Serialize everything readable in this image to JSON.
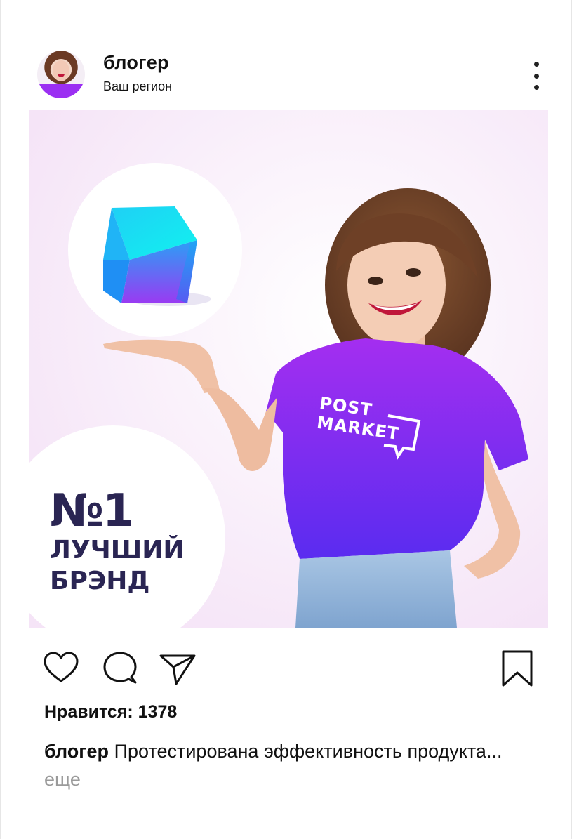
{
  "header": {
    "username": "блогер",
    "region": "Ваш регион",
    "more_icon": "more-vertical-icon"
  },
  "post": {
    "badge_title": "№1",
    "badge_line1": "ЛУЧШИЙ",
    "badge_line2": "БРЭНД",
    "tshirt_line1": "POST",
    "tshirt_line2": "MARKET",
    "colors": {
      "brand_purple": "#9b2ff2",
      "brand_blue": "#5a2bf0",
      "cube_cyan": "#10f0f0",
      "cube_magenta": "#d02af0",
      "badge_text": "#2a2553"
    }
  },
  "actions": {
    "like_icon": "heart-icon",
    "comment_icon": "comment-icon",
    "share_icon": "send-icon",
    "save_icon": "bookmark-icon"
  },
  "likes": {
    "text": "Нравится: 1378"
  },
  "caption": {
    "user": "блогер",
    "text": " Протестирована эффективность продукта...",
    "more": " еще"
  }
}
